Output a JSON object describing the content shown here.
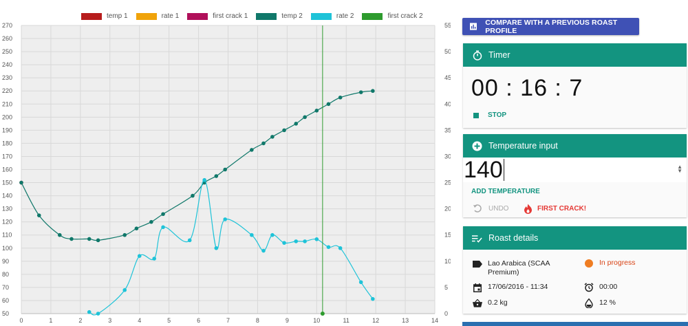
{
  "chart_data": {
    "type": "line",
    "title": "",
    "x_ticks": [
      0,
      1,
      2,
      3,
      4,
      5,
      6,
      7,
      8,
      9,
      10,
      11,
      12,
      13,
      14
    ],
    "y_left_ticks": [
      50,
      60,
      70,
      80,
      90,
      100,
      110,
      120,
      130,
      140,
      150,
      160,
      170,
      180,
      190,
      200,
      210,
      220,
      230,
      240,
      250,
      260,
      270
    ],
    "y_right_ticks": [
      0,
      5,
      10,
      15,
      20,
      25,
      30,
      35,
      40,
      45,
      50,
      55
    ],
    "xlim": [
      0,
      14
    ],
    "ylim_left": [
      50,
      270
    ],
    "ylim_right": [
      0,
      55
    ],
    "grid": true,
    "legend_position": "top",
    "series": [
      {
        "name": "temp 1",
        "color": "#b71c1c",
        "axis": "left",
        "points": [
          [
            0,
            150
          ]
        ]
      },
      {
        "name": "rate 1",
        "color": "#f0a30a",
        "axis": "right",
        "points": []
      },
      {
        "name": "first crack 1",
        "color": "#b0105a",
        "axis": "left",
        "points": []
      },
      {
        "name": "temp 2",
        "color": "#10786a",
        "axis": "left",
        "points": [
          [
            0.0,
            150
          ],
          [
            0.6,
            125
          ],
          [
            1.3,
            110
          ],
          [
            1.7,
            107
          ],
          [
            2.3,
            107
          ],
          [
            2.6,
            106
          ],
          [
            3.5,
            110
          ],
          [
            3.9,
            115
          ],
          [
            4.4,
            120
          ],
          [
            4.8,
            126
          ],
          [
            5.8,
            140
          ],
          [
            6.2,
            150
          ],
          [
            6.6,
            155
          ],
          [
            6.9,
            160
          ],
          [
            7.8,
            175
          ],
          [
            8.2,
            180
          ],
          [
            8.5,
            185
          ],
          [
            8.9,
            190
          ],
          [
            9.3,
            195
          ],
          [
            9.6,
            200
          ],
          [
            10.0,
            205
          ],
          [
            10.4,
            210
          ],
          [
            10.8,
            215
          ],
          [
            11.5,
            219
          ],
          [
            11.9,
            220
          ]
        ]
      },
      {
        "name": "rate 2",
        "color": "#1ec3d8",
        "axis": "right",
        "points": [
          [
            2.3,
            0.3
          ],
          [
            2.6,
            0
          ],
          [
            3.5,
            4.5
          ],
          [
            4.0,
            11
          ],
          [
            4.5,
            10.5
          ],
          [
            4.8,
            16.5
          ],
          [
            5.7,
            14
          ],
          [
            6.2,
            25.5
          ],
          [
            6.6,
            12.5
          ],
          [
            6.9,
            18
          ],
          [
            7.8,
            15
          ],
          [
            8.2,
            12
          ],
          [
            8.5,
            15
          ],
          [
            8.9,
            13.5
          ],
          [
            9.3,
            13.8
          ],
          [
            9.6,
            13.8
          ],
          [
            10.0,
            14.2
          ],
          [
            10.4,
            12.7
          ],
          [
            10.8,
            12.5
          ],
          [
            11.5,
            6
          ],
          [
            11.9,
            2.8
          ]
        ]
      },
      {
        "name": "first crack 2",
        "color": "#2e9b2e",
        "axis": "left",
        "vertical_x": 10.2
      }
    ]
  },
  "panel": {
    "compare_label": "COMPARE WITH A PREVIOUS ROAST PROFILE",
    "timer": {
      "title": "Timer",
      "value": "00 : 16 : 7",
      "stop_label": "STOP"
    },
    "temperature": {
      "title": "Temperature input",
      "value": "140",
      "add_label": "ADD TEMPERATURE",
      "undo_label": "UNDO",
      "first_crack_label": "FIRST CRACK!"
    },
    "details": {
      "title": "Roast details",
      "coffee": "Lao Arabica (SCAA Premium)",
      "status": "In progress",
      "date": "17/06/2016 - 11:34",
      "duration": "00:00",
      "weight": "0.2 kg",
      "humidity": "12 %"
    }
  },
  "colors": {
    "accent": "#139480",
    "compare": "#3f51b5",
    "alert": "#e53935",
    "status": "#ef7d22"
  },
  "icons": {
    "compare": "bar-chart-icon",
    "timer": "stopwatch-icon",
    "stop": "stop-icon",
    "temperature": "plus-circle-icon",
    "undo": "undo-icon",
    "first_crack": "flame-icon",
    "details": "checklist-icon",
    "coffee": "tag-icon",
    "date": "calendar-icon",
    "duration": "alarm-icon",
    "weight": "basket-icon",
    "humidity": "droplet-icon"
  }
}
